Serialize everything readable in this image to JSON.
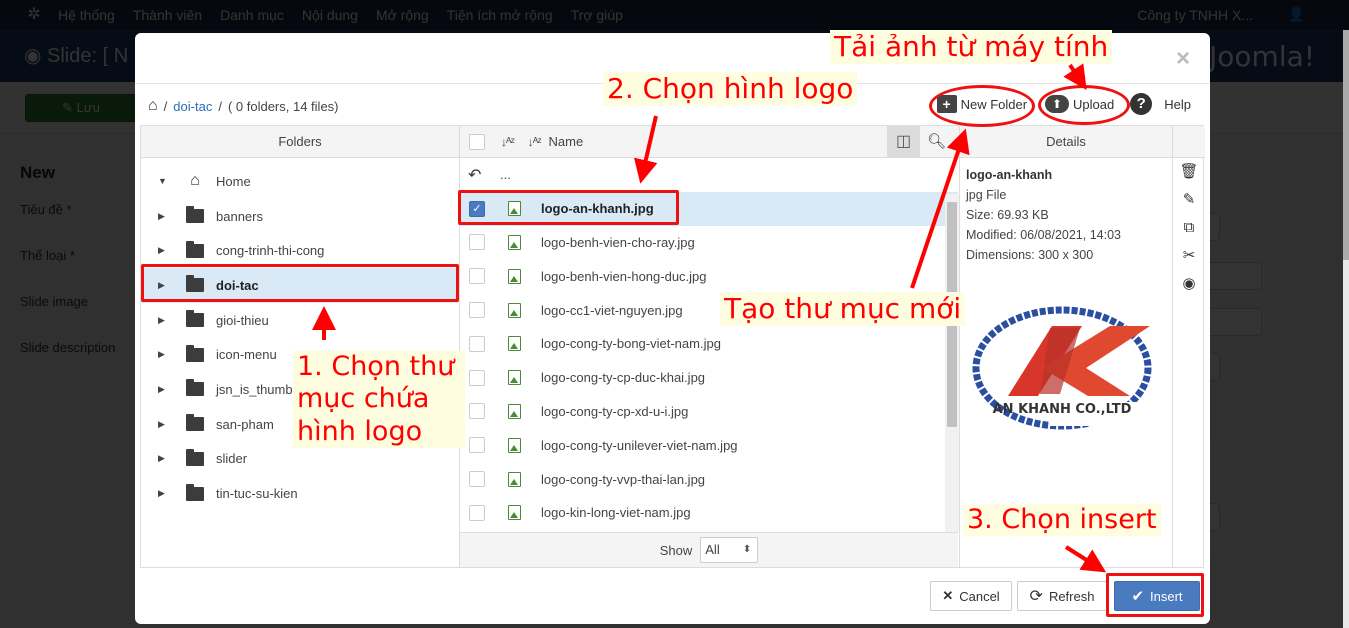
{
  "background_app": {
    "topnav": [
      "Hệ thống",
      "Thành viên",
      "Danh mục",
      "Nội dung",
      "Mở rộng",
      "Tiện ích mở rộng",
      "Trợ giúp"
    ],
    "site_name": "Công ty TNHH X...",
    "page_title": "Slide: [ N",
    "brand": "Joomla!",
    "save_label": "Lưu",
    "form_heading": "New",
    "form_labels": [
      "Tiêu đề *",
      "Thể loại *",
      "Slide image",
      "Slide description"
    ]
  },
  "modal": {
    "close_label": "×",
    "breadcrumb": {
      "home_icon": "home-icon",
      "folder": "doi-tac",
      "summary": "( 0 folders, 14 files)"
    },
    "actions": {
      "new_folder": "New Folder",
      "upload": "Upload",
      "help": "Help"
    },
    "folders_header": "Folders",
    "folders": [
      {
        "name": "Home",
        "icon": "home-icon",
        "expanded": true,
        "selected": false
      },
      {
        "name": "banners",
        "icon": "folder-icon",
        "selected": false
      },
      {
        "name": "cong-trinh-thi-cong",
        "icon": "folder-icon",
        "selected": false
      },
      {
        "name": "doi-tac",
        "icon": "folder-icon",
        "selected": true
      },
      {
        "name": "gioi-thieu",
        "icon": "folder-icon",
        "selected": false
      },
      {
        "name": "icon-menu",
        "icon": "folder-icon",
        "selected": false
      },
      {
        "name": "jsn_is_thumbs",
        "icon": "folder-icon",
        "selected": false
      },
      {
        "name": "san-pham",
        "icon": "folder-icon",
        "selected": false
      },
      {
        "name": "slider",
        "icon": "folder-icon",
        "selected": false
      },
      {
        "name": "tin-tuc-su-kien",
        "icon": "folder-icon",
        "selected": false
      }
    ],
    "files_header": {
      "name_col": "Name"
    },
    "parent_label": "...",
    "files": [
      {
        "name": "logo-an-khanh.jpg",
        "checked": true
      },
      {
        "name": "logo-benh-vien-cho-ray.jpg",
        "checked": false
      },
      {
        "name": "logo-benh-vien-hong-duc.jpg",
        "checked": false
      },
      {
        "name": "logo-cc1-viet-nguyen.jpg",
        "checked": false
      },
      {
        "name": "logo-cong-ty-bong-viet-nam.jpg",
        "checked": false
      },
      {
        "name": "logo-cong-ty-cp-duc-khai.jpg",
        "checked": false
      },
      {
        "name": "logo-cong-ty-cp-xd-u-i.jpg",
        "checked": false
      },
      {
        "name": "logo-cong-ty-unilever-viet-nam.jpg",
        "checked": false
      },
      {
        "name": "logo-cong-ty-vvp-thai-lan.jpg",
        "checked": false
      },
      {
        "name": "logo-kin-long-viet-nam.jpg",
        "checked": false
      }
    ],
    "show_label": "Show",
    "show_value": "All",
    "details_header": "Details",
    "details": {
      "name": "logo-an-khanh",
      "type": "jpg File",
      "size": "Size: 69.93 KB",
      "modified": "Modified: 06/08/2021, 14:03",
      "dimensions": "Dimensions: 300 x 300",
      "preview_text": "AN KHANH CO.,LTD"
    },
    "buttons": {
      "cancel": "Cancel",
      "refresh": "Refresh",
      "insert": "Insert"
    }
  },
  "annotations": {
    "step1": "1. Chọn thư mục chứa hình logo",
    "step2": "2. Chọn hình logo",
    "step3": "3. Chọn insert",
    "upload_note": "Tải ảnh từ máy tính",
    "new_folder_note": "Tạo thư mục mới",
    "color": "#ff0000"
  }
}
